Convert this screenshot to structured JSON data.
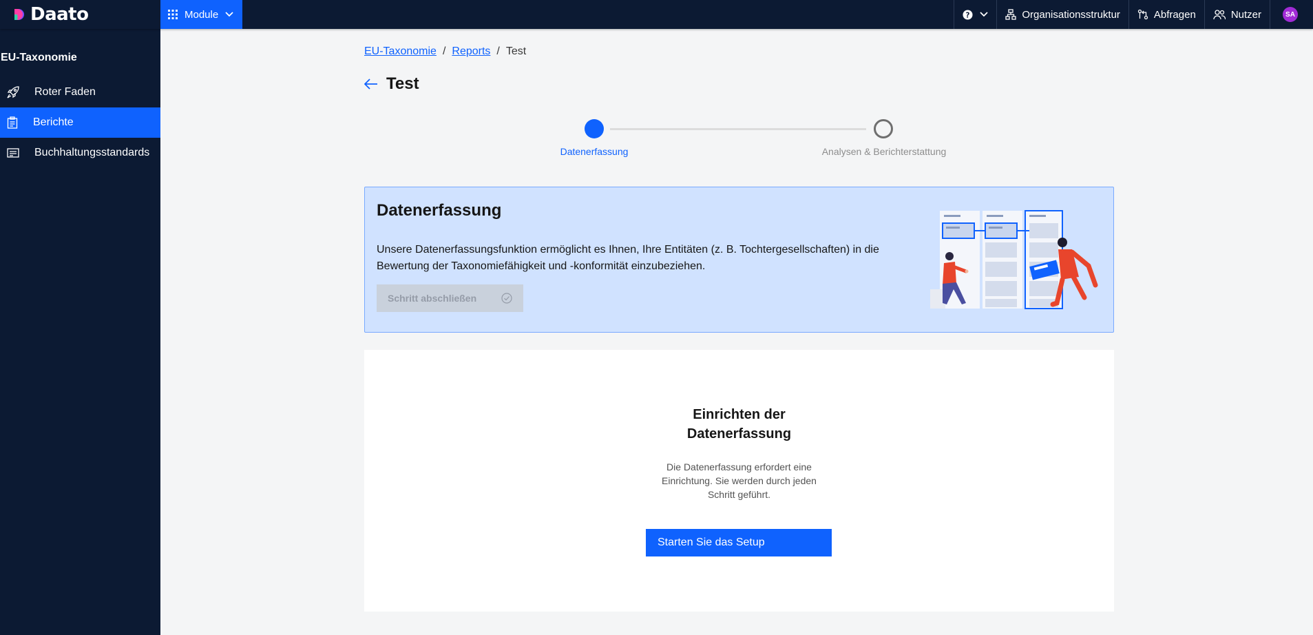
{
  "header": {
    "brand": "Daato",
    "module_label": "Module",
    "nav": [
      {
        "label": "Organisationsstruktur",
        "icon": "org-structure-icon"
      },
      {
        "label": "Abfragen",
        "icon": "requests-icon"
      },
      {
        "label": "Nutzer",
        "icon": "users-icon"
      }
    ],
    "avatar_initials": "SA"
  },
  "sidebar": {
    "section_title": "EU-Taxonomie",
    "items": [
      {
        "label": "Roter Faden",
        "icon": "rocket-icon",
        "active": false
      },
      {
        "label": "Berichte",
        "icon": "report-icon",
        "active": true
      },
      {
        "label": "Buchhaltungsstandards",
        "icon": "document-icon",
        "active": false
      }
    ]
  },
  "breadcrumb": {
    "items": [
      "EU-Taxonomie",
      "Reports",
      "Test"
    ],
    "separator": "/"
  },
  "page": {
    "title": "Test"
  },
  "stepper": {
    "steps": [
      {
        "label": "Datenerfassung",
        "state": "current"
      },
      {
        "label": "Analysen & Berichterstattung",
        "state": "upcoming"
      }
    ]
  },
  "info_card": {
    "title": "Datenerfassung",
    "text": "Unsere Datenerfassungsfunktion ermöglicht es Ihnen, Ihre Entitäten (z. B. Tochtergesellschaften) in die Bewertung der Taxonomiefähigkeit und -konformität einzubeziehen.",
    "button_label": "Schritt abschließen"
  },
  "setup_card": {
    "title_line1": "Einrichten der",
    "title_line2": "Datenerfassung",
    "description": "Die Datenerfassung erfordert eine Einrichtung. Sie werden durch jeden Schritt geführt.",
    "button_label": "Starten Sie das Setup"
  },
  "colors": {
    "primary": "#0f62fe",
    "nav_bg": "#0c1a33",
    "info_bg": "#d0e2ff",
    "avatar": "#a12bd6"
  }
}
